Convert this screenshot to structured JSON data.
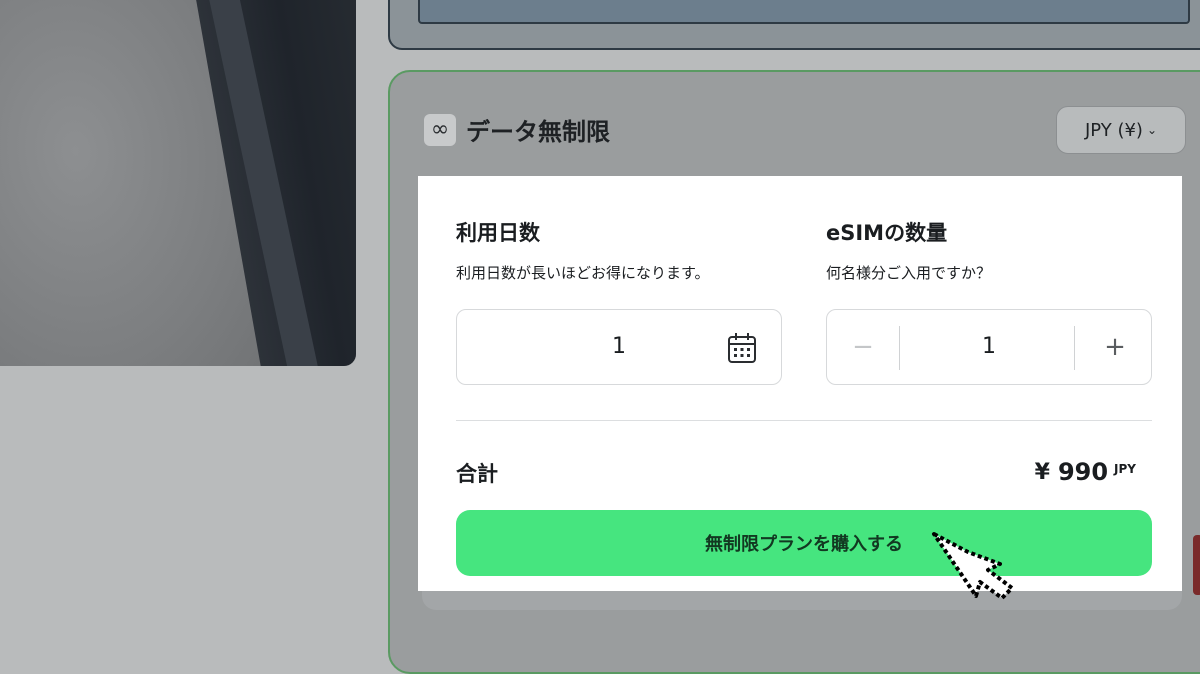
{
  "plan": {
    "icon": "infinity-icon",
    "icon_glyph": "∞",
    "title": "データ無制限"
  },
  "currency": {
    "label": "JPY (¥)",
    "chevron": "⌄"
  },
  "days": {
    "title": "利用日数",
    "subtitle": "利用日数が長いほどお得になります。",
    "value": "1",
    "icon": "calendar-icon"
  },
  "quantity": {
    "title": "eSIMの数量",
    "subtitle": "何名様分ご入用ですか？",
    "value": "1",
    "minus": "−",
    "plus": "+"
  },
  "total": {
    "label": "合計",
    "yen": "¥",
    "amount": "990",
    "currency": "JPY"
  },
  "buy_button": {
    "label": "無制限プランを購入する"
  },
  "colors": {
    "accent": "#46e57f",
    "panel": "#ffffff"
  }
}
